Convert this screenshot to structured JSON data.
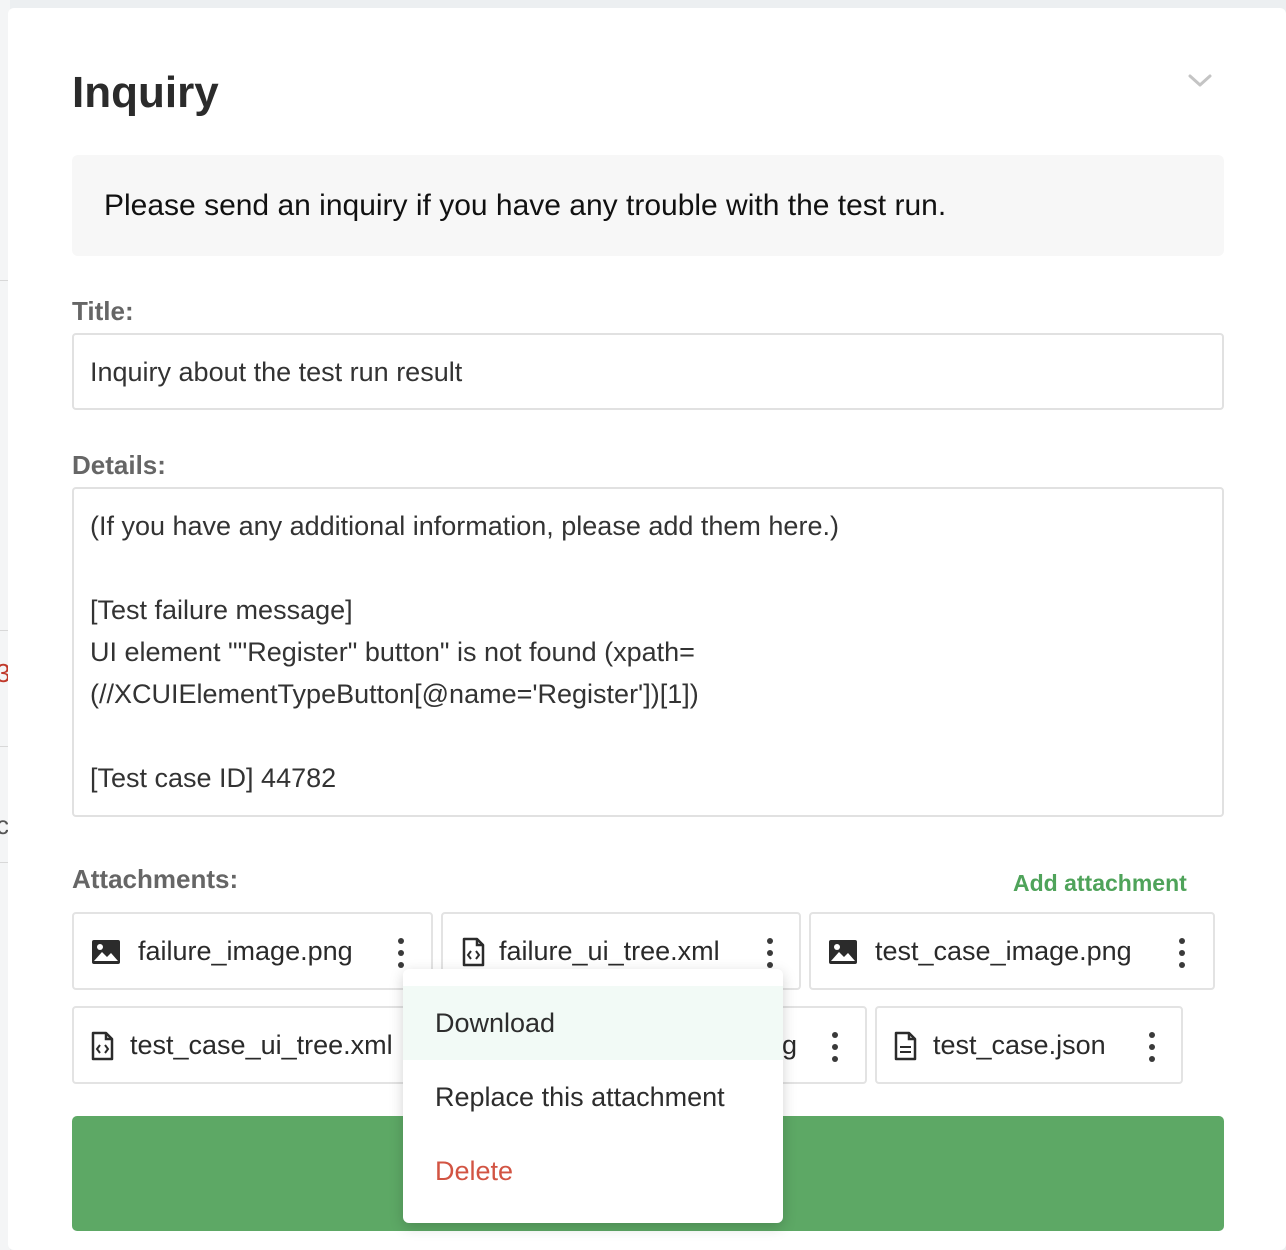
{
  "background": {
    "edge_glyph_1": "3",
    "edge_glyph_2": "c"
  },
  "header": {
    "title": "Inquiry",
    "collapse_icon": "chevron-down-icon"
  },
  "notice": {
    "text": "Please send an inquiry if you have any trouble with the test run."
  },
  "form": {
    "title_label": "Title:",
    "title_value": "Inquiry about the test run result",
    "details_label": "Details:",
    "details_lines": [
      "(If you have any additional information, please add them here.)",
      "",
      "[Test failure message]",
      "UI element \"\"Register\" button\" is not found (xpath=",
      "(//XCUIElementTypeButton[@name='Register'])[1])",
      "",
      "[Test case ID] 44782"
    ]
  },
  "attachments": {
    "label": "Attachments:",
    "add_label": "Add attachment",
    "items": [
      {
        "name": "failure_image.png",
        "icon": "image-icon"
      },
      {
        "name": "failure_ui_tree.xml",
        "icon": "code-file-icon"
      },
      {
        "name": "test_case_image.png",
        "icon": "image-icon"
      },
      {
        "name": "test_case_ui_tree.xml",
        "icon": "code-file-icon"
      },
      {
        "name": "test_case_image_2.png",
        "visible_text": "g",
        "icon": "image-icon"
      },
      {
        "name": "test_case.json",
        "icon": "text-file-icon"
      }
    ]
  },
  "submit": {
    "label": ""
  },
  "menu": {
    "items": [
      {
        "label": "Download",
        "state": "hover"
      },
      {
        "label": "Replace this attachment"
      },
      {
        "label": "Delete",
        "style": "danger"
      }
    ]
  },
  "colors": {
    "accent_green": "#5da865",
    "link_green": "#4fa35a",
    "danger_red": "#d25443",
    "notice_bg": "#f7f7f7"
  }
}
